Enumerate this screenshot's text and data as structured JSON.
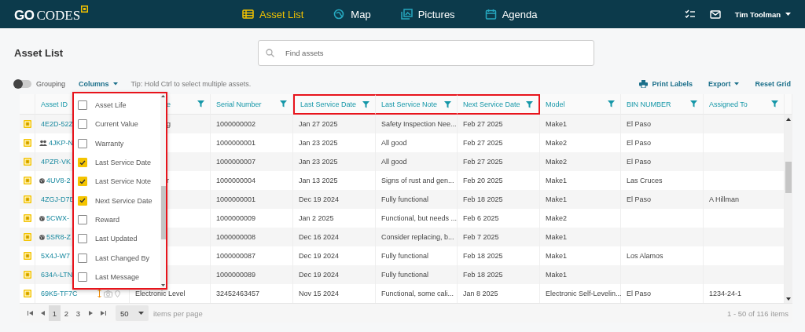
{
  "header": {
    "logo_strong": "GO",
    "logo_rest": "CODES",
    "nav": [
      {
        "label": "Asset List",
        "kind": "table",
        "selected": true
      },
      {
        "label": "Map",
        "kind": "map",
        "selected": false
      },
      {
        "label": "Pictures",
        "kind": "pictures",
        "selected": false
      },
      {
        "label": "Agenda",
        "kind": "calendar",
        "selected": false
      }
    ],
    "user": "Tim Toolman"
  },
  "page": {
    "title": "Asset List",
    "search": {
      "placeholder": "Find assets"
    }
  },
  "toolbar": {
    "grouping": {
      "label": "Grouping",
      "on": false
    },
    "columns_button": "Columns",
    "tip": "Tip: Hold Ctrl to select multiple assets.",
    "actions": [
      {
        "label": "Print Labels",
        "kind": "print"
      },
      {
        "label": "Export",
        "kind": "menu"
      },
      {
        "label": "Reset Grid",
        "kind": "plain"
      }
    ]
  },
  "table": {
    "columns": [
      {
        "label": "Asset ID",
        "filter": false,
        "highlighted": false
      },
      {
        "label": "e",
        "filter": true,
        "highlighted": false
      },
      {
        "label": "Serial Number",
        "filter": true,
        "highlighted": false
      },
      {
        "label": "Last Service Date",
        "filter": true,
        "highlighted": true
      },
      {
        "label": "Last Service Note",
        "filter": true,
        "highlighted": true
      },
      {
        "label": "Next Service Date",
        "filter": true,
        "highlighted": true
      },
      {
        "label": "Model",
        "filter": true,
        "highlighted": false
      },
      {
        "label": "BIN NUMBER",
        "filter": true,
        "highlighted": false
      },
      {
        "label": "Assigned To",
        "filter": true,
        "highlighted": false
      }
    ],
    "rows": [
      {
        "kind": "plain",
        "cells": [
          "4E2D-52Z",
          "g",
          "1000000002",
          "Jan 27 2025",
          "Safety Inspection Nee...",
          "Feb 27 2025",
          "Make1",
          "El Paso",
          null
        ]
      },
      {
        "kind": "group",
        "cells": [
          "4JKP-N",
          null,
          "1000000001",
          "Jan 23 2025",
          "All good",
          "Feb 27 2025",
          "Make2",
          "El Paso",
          null
        ]
      },
      {
        "kind": "plain",
        "cells": [
          "4PZR-VK",
          null,
          "1000000007",
          "Jan 23 2025",
          "All good",
          "Feb 27 2025",
          "Make2",
          "El Paso",
          null
        ]
      },
      {
        "kind": "globe",
        "cells": [
          "4UV8-2",
          "r",
          "1000000004",
          "Jan 13 2025",
          "Signs of rust and gen...",
          "Feb 20 2025",
          "Make1",
          "Las Cruces",
          null
        ]
      },
      {
        "kind": "plain",
        "cells": [
          "4ZGJ-D7E",
          null,
          "1000000001",
          "Dec 19 2024",
          "Fully functional",
          "Feb 18 2025",
          "Make1",
          "El Paso",
          "A Hillman"
        ]
      },
      {
        "kind": "globe",
        "cells": [
          "5CWX-",
          null,
          "1000000009",
          "Jan 2 2025",
          "Functional, but needs ...",
          "Feb 6 2025",
          "Make2",
          null,
          null
        ]
      },
      {
        "kind": "globe",
        "cells": [
          "5SR8-Z",
          null,
          "1000000008",
          "Dec 16 2024",
          "Consider replacing, b...",
          "Feb 7 2025",
          "Make1",
          null,
          null
        ]
      },
      {
        "kind": "plain",
        "cells": [
          "5X4J-W7",
          null,
          "1000000087",
          "Dec 19 2024",
          "Fully functional",
          "Feb 18 2025",
          "Make1",
          "Los Alamos",
          null
        ]
      },
      {
        "kind": "plain",
        "cells": [
          "634A-LTN",
          null,
          "1000000089",
          "Dec 19 2024",
          "Fully functional",
          "Feb 18 2025",
          "Make1",
          null,
          null
        ]
      },
      {
        "kind": "media",
        "cells": [
          "69K5-TF7C",
          "Electronic Level",
          "32452463457",
          "Nov 15 2024",
          "Functional, some cali...",
          "Jan 8 2025",
          "Electronic Self-Levelin...",
          "El Paso",
          "1234-24-1"
        ]
      }
    ]
  },
  "column_menu": {
    "items": [
      {
        "label": "Asset Life",
        "checked": false
      },
      {
        "label": "Current Value",
        "checked": false
      },
      {
        "label": "Warranty",
        "checked": false
      },
      {
        "label": "Last Service Date",
        "checked": true
      },
      {
        "label": "Last Service Note",
        "checked": true
      },
      {
        "label": "Next Service Date",
        "checked": true
      },
      {
        "label": "Reward",
        "checked": false
      },
      {
        "label": "Last Updated",
        "checked": false
      },
      {
        "label": "Last Changed By",
        "checked": false
      },
      {
        "label": "Last Message",
        "checked": false
      }
    ]
  },
  "pager": {
    "pages": [
      {
        "label": "1",
        "selected": true
      },
      {
        "label": "2",
        "selected": false
      },
      {
        "label": "3",
        "selected": false
      }
    ],
    "page_size": "50",
    "page_size_label": "items per page",
    "summary": "1 - 50 of 116 items"
  }
}
